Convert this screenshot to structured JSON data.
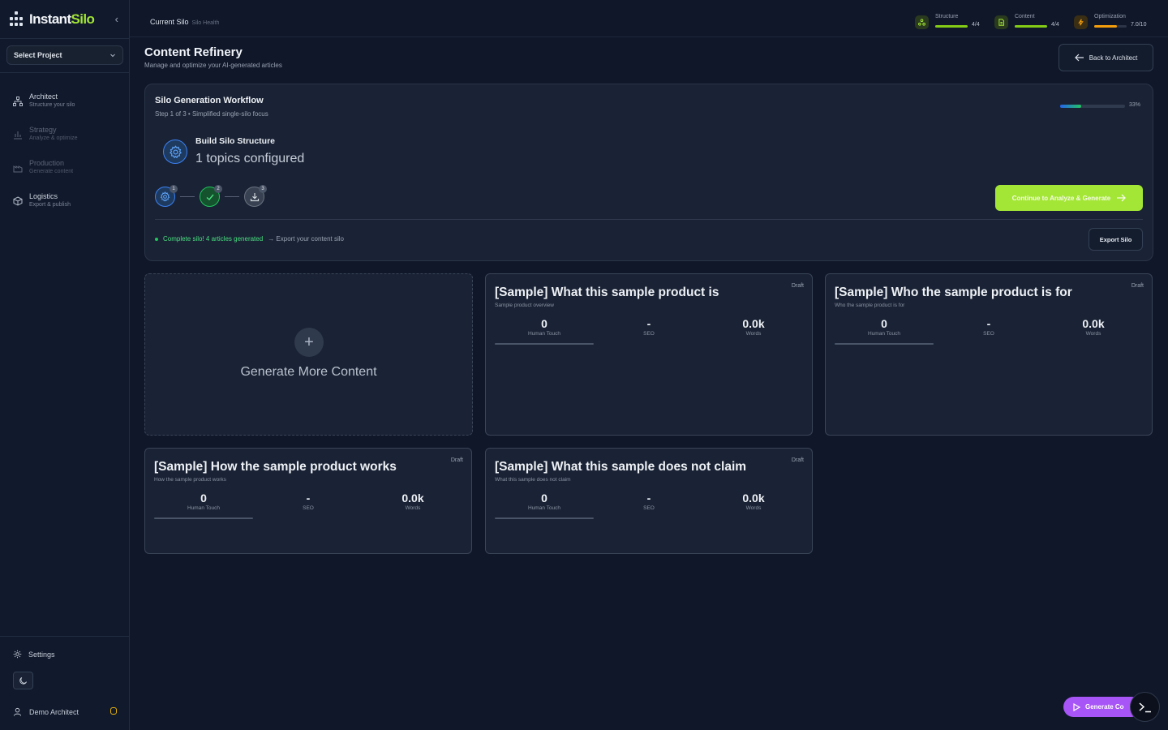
{
  "app": {
    "name_part1": "Instant",
    "name_part2": "Silo"
  },
  "sidebar": {
    "project_select": "Select Project",
    "items": [
      {
        "label": "Architect",
        "sub": "Structure your silo"
      },
      {
        "label": "Strategy",
        "sub": "Analyze & optimize"
      },
      {
        "label": "Production",
        "sub": "Generate content"
      },
      {
        "label": "Logistics",
        "sub": "Export & publish"
      }
    ],
    "settings_label": "Settings",
    "user_name": "Demo Architect"
  },
  "topbar": {
    "crumb_main": "Current Silo",
    "crumb_sub": "Silo Health",
    "metrics": [
      {
        "label": "Structure",
        "value": "4/4",
        "fill": 1.0,
        "color": "#84cc16"
      },
      {
        "label": "Content",
        "value": "4/4",
        "fill": 1.0,
        "color": "#84cc16"
      },
      {
        "label": "Optimization",
        "value": "7.0/10",
        "fill": 0.7,
        "color": "#f59e0b"
      }
    ]
  },
  "header": {
    "title": "Content Refinery",
    "subtitle": "Manage and optimize your AI-generated articles",
    "back_label": "Back to Architect"
  },
  "workflow": {
    "title": "Silo Generation Workflow",
    "subtitle": "Step 1 of 3 • Simplified single-silo focus",
    "progress_pct": 33,
    "progress_label": "33%",
    "step_title": "Build Silo Structure",
    "step_detail": "1 topics configured",
    "steps": [
      "1",
      "2",
      "3"
    ],
    "continue_label": "Continue to Analyze & Generate",
    "status_text": "Complete silo! 4 articles generated",
    "status_next": "→ Export your content silo",
    "export_label": "Export Silo"
  },
  "generate_card": {
    "label": "Generate More Content"
  },
  "cards": [
    {
      "title": "[Sample] What this sample product is",
      "sub": "Sample product overview",
      "status": "Draft",
      "human_touch": "0",
      "seo": "-",
      "words": "0.0k"
    },
    {
      "title": "[Sample] Who the sample product is for",
      "sub": "Who the sample product is for",
      "status": "Draft",
      "human_touch": "0",
      "seo": "-",
      "words": "0.0k"
    },
    {
      "title": "[Sample] How the sample product works",
      "sub": "How the sample product works",
      "status": "Draft",
      "human_touch": "0",
      "seo": "-",
      "words": "0.0k"
    },
    {
      "title": "[Sample] What this sample does not claim",
      "sub": "What this sample does not claim",
      "status": "Draft",
      "human_touch": "0",
      "seo": "-",
      "words": "0.0k"
    }
  ],
  "stat_labels": {
    "human_touch": "Human Touch",
    "seo": "SEO",
    "words": "Words"
  },
  "fab": {
    "label": "Generate Co"
  }
}
